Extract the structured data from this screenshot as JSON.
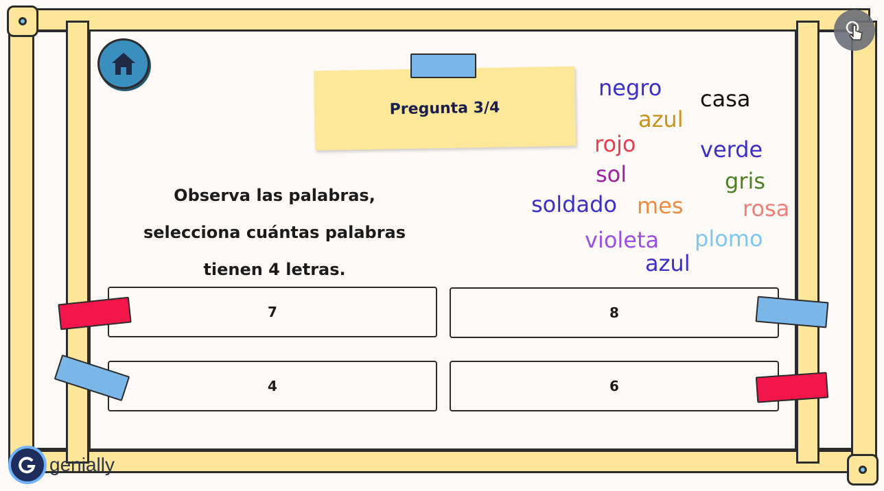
{
  "header": {
    "title": "Pregunta 3/4"
  },
  "question": {
    "lines": [
      "Observa las palabras,",
      "selecciona cuántas palabras",
      "tienen 4 letras."
    ]
  },
  "answers": [
    "7",
    "8",
    "4",
    "6"
  ],
  "words": [
    {
      "text": "negro",
      "color": "#3b2fc9"
    },
    {
      "text": "casa",
      "color": "#111111"
    },
    {
      "text": "azul",
      "color": "#c8931a"
    },
    {
      "text": "rojo",
      "color": "#e83e4c"
    },
    {
      "text": "verde",
      "color": "#3b2fc9"
    },
    {
      "text": "sol",
      "color": "#a01f9f"
    },
    {
      "text": "gris",
      "color": "#4e7f24"
    },
    {
      "text": "soldado",
      "color": "#3b2fc9"
    },
    {
      "text": "mes",
      "color": "#f08a3c"
    },
    {
      "text": "rosa",
      "color": "#ef7f76"
    },
    {
      "text": "violeta",
      "color": "#9b4fe0"
    },
    {
      "text": "plomo",
      "color": "#7fc6f0"
    },
    {
      "text": "azul",
      "color": "#3b2fc9"
    }
  ],
  "branding": {
    "name": "genially"
  },
  "icons": {
    "home": "home-icon",
    "share": "hand-pointer-icon",
    "logo": "genially-logo-icon"
  }
}
